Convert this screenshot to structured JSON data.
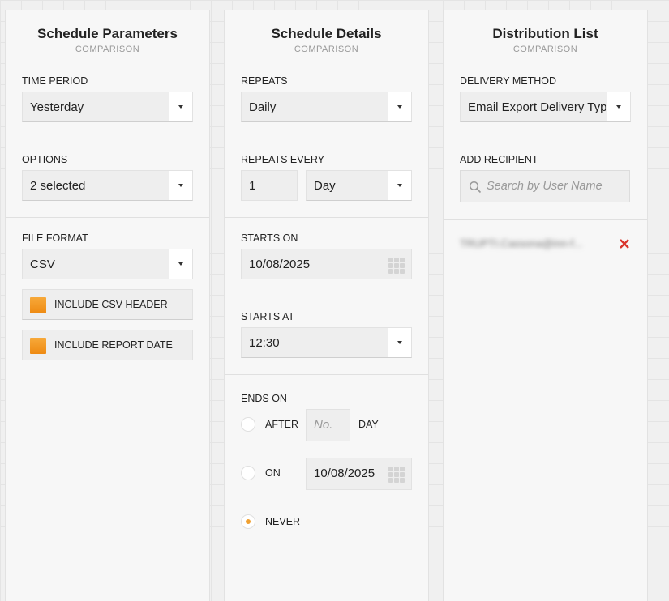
{
  "panels": {
    "params": {
      "title": "Schedule Parameters",
      "subtitle": "COMPARISON",
      "time_period": {
        "label": "TIME PERIOD",
        "value": "Yesterday"
      },
      "options": {
        "label": "OPTIONS",
        "value": "2 selected"
      },
      "file_format": {
        "label": "FILE FORMAT",
        "value": "CSV"
      },
      "checkboxes": [
        {
          "label": "INCLUDE CSV HEADER",
          "checked": true
        },
        {
          "label": "INCLUDE REPORT DATE",
          "checked": true
        }
      ]
    },
    "details": {
      "title": "Schedule Details",
      "subtitle": "COMPARISON",
      "repeats": {
        "label": "REPEATS",
        "value": "Daily"
      },
      "repeats_every": {
        "label": "REPEATS EVERY",
        "count": "1",
        "unit": "Day"
      },
      "starts_on": {
        "label": "STARTS ON",
        "value": "10/08/2025"
      },
      "starts_at": {
        "label": "STARTS AT",
        "value": "12:30"
      },
      "ends_on": {
        "label": "ENDS ON",
        "after_label": "AFTER",
        "after_placeholder": "No.",
        "after_unit": "DAY",
        "on_label": "ON",
        "on_date": "10/08/2025",
        "never_label": "NEVER",
        "selected": "never"
      }
    },
    "distribution": {
      "title": "Distribution List",
      "subtitle": "COMPARISON",
      "delivery_method": {
        "label": "DELIVERY METHOD",
        "value": "Email Export Delivery Type"
      },
      "add_recipient": {
        "label": "ADD RECIPIENT",
        "placeholder": "Search by User Name"
      },
      "recipients": [
        "TRUPTI.Cassona@inn-f..."
      ]
    }
  },
  "colors": {
    "checkbox": "#F0962A",
    "radio_selected": "#F0A030",
    "remove": "#D9342B"
  }
}
